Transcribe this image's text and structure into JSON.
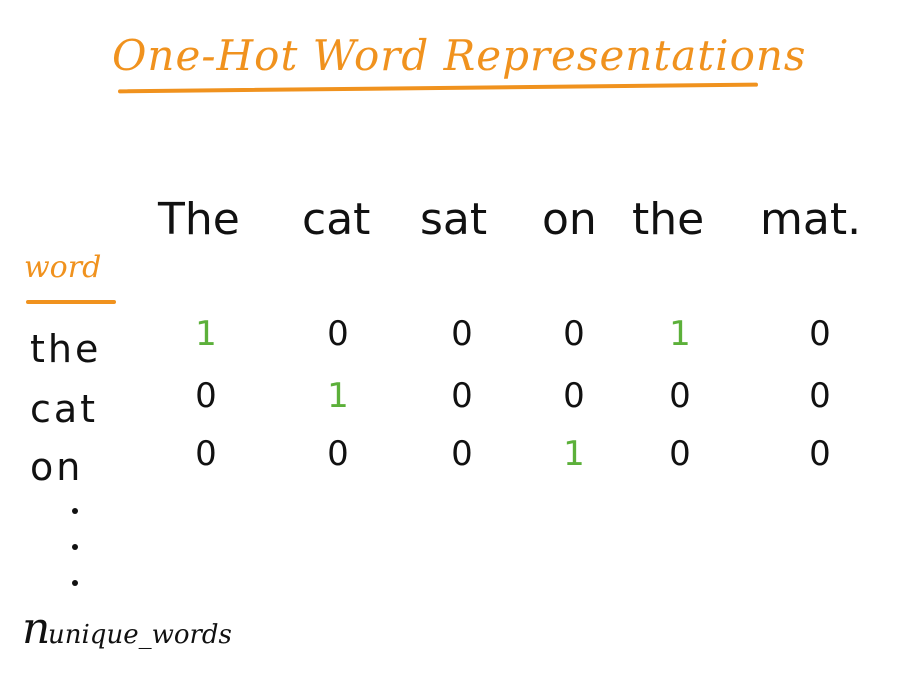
{
  "title": "One-Hot Word Representations",
  "word_label": "word",
  "sentence": [
    "The",
    "cat",
    "sat",
    "on",
    "the",
    "mat."
  ],
  "rows": [
    {
      "label": "the",
      "values": [
        "1",
        "0",
        "0",
        "0",
        "1",
        "0"
      ]
    },
    {
      "label": "cat",
      "values": [
        "0",
        "1",
        "0",
        "0",
        "0",
        "0"
      ]
    },
    {
      "label": "on",
      "values": [
        "0",
        "0",
        "0",
        "1",
        "0",
        "0"
      ]
    }
  ],
  "n_label": "n",
  "n_subscript": "unique_words",
  "colors": {
    "accent": "#f0921e",
    "one": "#5cb03a",
    "zero": "#111111"
  }
}
